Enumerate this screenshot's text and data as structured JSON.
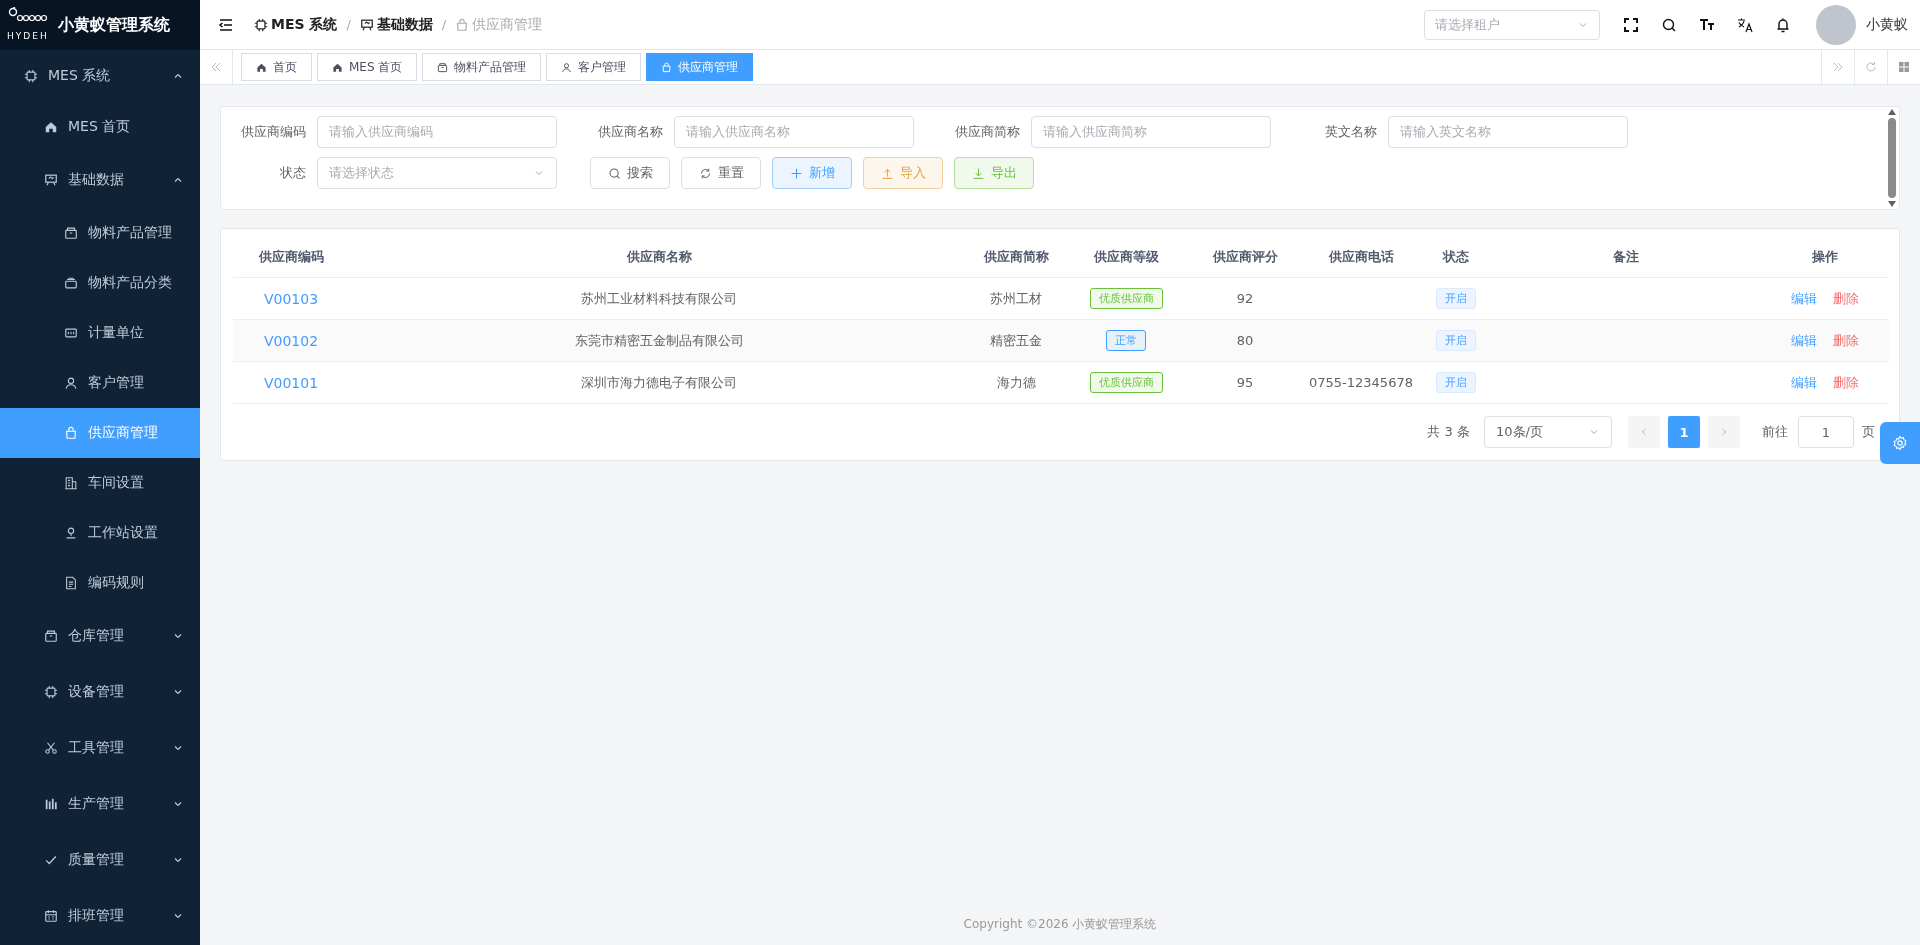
{
  "app": {
    "title": "小黄蚁管理系统",
    "logo_text": "HYDEH"
  },
  "sidebar": {
    "items": [
      {
        "label": "MES 系统",
        "expanded": true,
        "children": [
          {
            "label": "MES 首页",
            "selected": false
          },
          {
            "label": "基础数据",
            "expanded": true,
            "children": [
              {
                "label": "物料产品管理",
                "selected": false
              },
              {
                "label": "物料产品分类",
                "selected": false
              },
              {
                "label": "计量单位",
                "selected": false
              },
              {
                "label": "客户管理",
                "selected": false
              },
              {
                "label": "供应商管理",
                "selected": true
              },
              {
                "label": "车间设置",
                "selected": false
              },
              {
                "label": "工作站设置",
                "selected": false
              },
              {
                "label": "编码规则",
                "selected": false
              }
            ]
          },
          {
            "label": "仓库管理",
            "expanded": false
          },
          {
            "label": "设备管理",
            "expanded": false
          },
          {
            "label": "工具管理",
            "expanded": false
          },
          {
            "label": "生产管理",
            "expanded": false
          },
          {
            "label": "质量管理",
            "expanded": false
          },
          {
            "label": "排班管理",
            "expanded": false
          }
        ]
      }
    ]
  },
  "header": {
    "breadcrumb": [
      {
        "label": "MES 系统"
      },
      {
        "label": "基础数据"
      },
      {
        "label": "供应商管理"
      }
    ],
    "breadcrumb_separator": "/",
    "tenant_select": {
      "placeholder": "请选择租户"
    },
    "user": {
      "name": "小黄蚁"
    }
  },
  "tabs": [
    {
      "label": "首页",
      "selected": false
    },
    {
      "label": "MES 首页",
      "selected": false
    },
    {
      "label": "物料产品管理",
      "selected": false
    },
    {
      "label": "客户管理",
      "selected": false
    },
    {
      "label": "供应商管理",
      "selected": true
    }
  ],
  "filters": [
    {
      "label": "供应商编码",
      "placeholder": "请输入供应商编码",
      "kind": "input"
    },
    {
      "label": "供应商名称",
      "placeholder": "请输入供应商名称",
      "kind": "input"
    },
    {
      "label": "供应商简称",
      "placeholder": "请输入供应商简称",
      "kind": "input"
    },
    {
      "label": "英文名称",
      "placeholder": "请输入英文名称",
      "kind": "input"
    },
    {
      "label": "状态",
      "placeholder": "请选择状态",
      "kind": "select"
    }
  ],
  "buttons": [
    {
      "label": "搜索",
      "kind": "default"
    },
    {
      "label": "重置",
      "kind": "default"
    },
    {
      "label": "新增",
      "kind": "primary"
    },
    {
      "label": "导入",
      "kind": "warning"
    },
    {
      "label": "导出",
      "kind": "success"
    }
  ],
  "table": {
    "columns": [
      "供应商编码",
      "供应商名称",
      "供应商简称",
      "供应商等级",
      "供应商评分",
      "供应商电话",
      "状态",
      "备注",
      "操作"
    ],
    "rows": [
      {
        "code": "V00103",
        "name": "苏州工业材料科技有限公司",
        "short": "苏州工材",
        "grade": {
          "label": "优质供应商",
          "color": "#67c23a"
        },
        "score": "92",
        "status": "开启",
        "actions": [
          "编辑",
          "删除"
        ]
      },
      {
        "code": "V00102",
        "name": "东莞市精密五金制品有限公司",
        "short": "精密五金",
        "grade": {
          "label": "正常",
          "color": "#409eff"
        },
        "score": "80",
        "status": "开启",
        "actions": [
          "编辑",
          "删除"
        ]
      },
      {
        "code": "V00101",
        "name": "深圳市海力德电子有限公司",
        "short": "海力德",
        "grade": {
          "label": "优质供应商",
          "color": "#67c23a"
        },
        "score": "95",
        "phone": "0755-12345678",
        "status": "开启",
        "actions": [
          "编辑",
          "删除"
        ]
      }
    ]
  },
  "pagination": {
    "total": "共 3 条",
    "page_size": "10条/页",
    "pages": [
      {
        "label": "1",
        "selected": true
      }
    ],
    "goto_label": "前往",
    "goto_value": "1",
    "goto_suffix": "页"
  },
  "footer": "Copyright ©2026 小黄蚁管理系统"
}
